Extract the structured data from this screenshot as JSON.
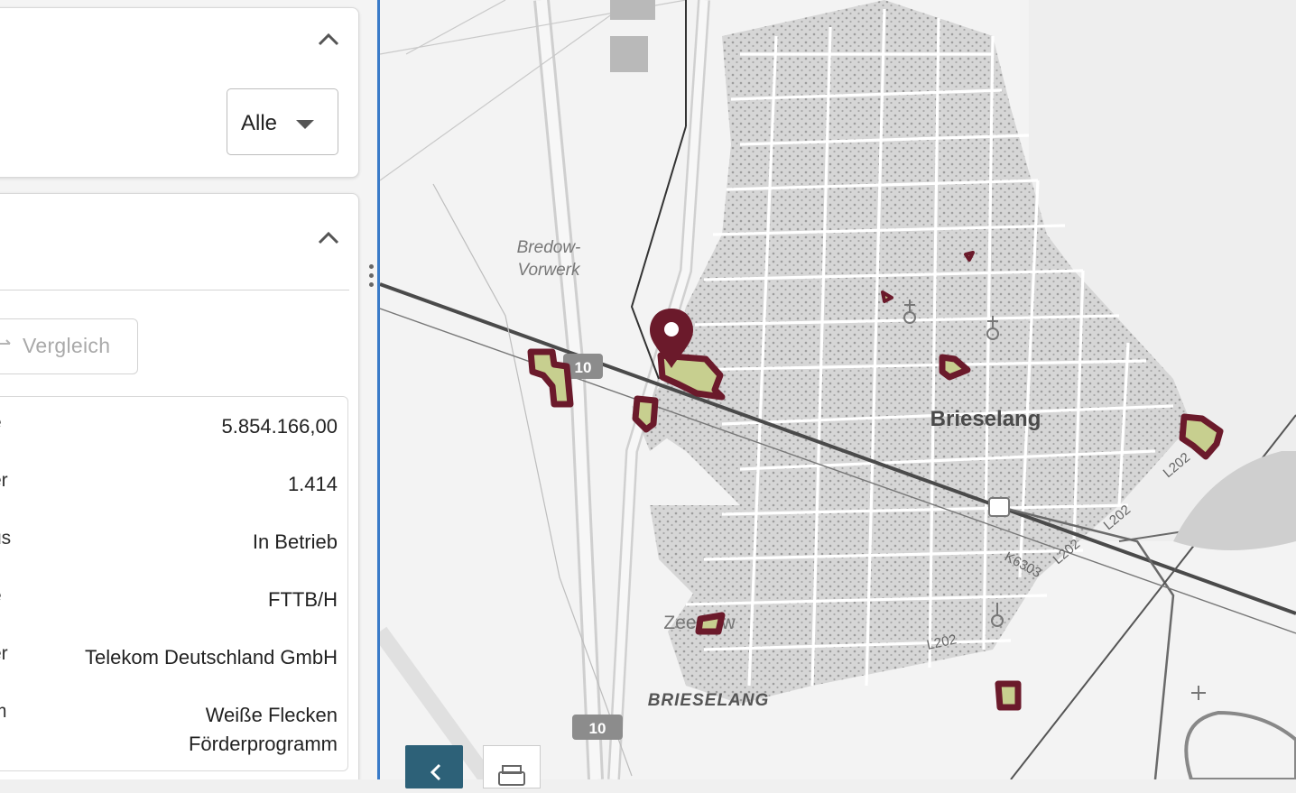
{
  "filter": {
    "selected": "Alle"
  },
  "compare": {
    "label": "Vergleich"
  },
  "details": [
    {
      "key": "e",
      "value": "5.854.166,00"
    },
    {
      "key": "er",
      "value": "1.414"
    },
    {
      "key": "us",
      "value": "In Betrieb"
    },
    {
      "key": "e",
      "value": "FTTB/H"
    },
    {
      "key": "er",
      "value": "Telekom Deutschland GmbH"
    },
    {
      "key": "m",
      "value": "Weiße Flecken",
      "value2": "Förderprogramm"
    }
  ],
  "map": {
    "labels": {
      "bredow": "Bredow-",
      "vorwerk": "Vorwerk",
      "brieselang": "Brieselang",
      "brieselang_caps": "BRIESELANG",
      "zeestow": "Zeestow",
      "road_a10_north": "10",
      "road_a10_south": "10",
      "road_l202_a": "L202",
      "road_l202_b": "L202",
      "road_l202_c": "L202",
      "road_l202_d": "L202",
      "road_k6303": "K6303"
    },
    "colors": {
      "area_outline": "#6b1a2b",
      "area_fill": "#c7cf8f",
      "splitter": "#3a7bc8",
      "collapse_button": "#2d6178"
    }
  }
}
